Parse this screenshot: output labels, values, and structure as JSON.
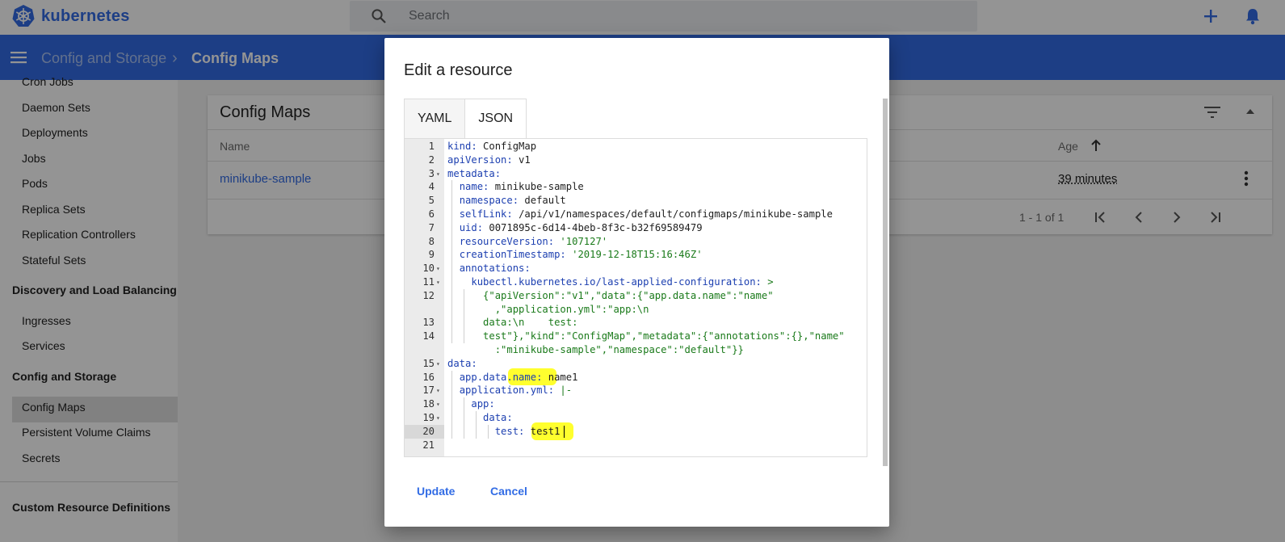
{
  "app": {
    "name": "kubernetes"
  },
  "search": {
    "placeholder": "Search"
  },
  "breadcrumb": {
    "parent": "Config and Storage",
    "current": "Config Maps"
  },
  "sidebar": {
    "items_top": [
      "Cron Jobs",
      "Daemon Sets",
      "Deployments",
      "Jobs",
      "Pods",
      "Replica Sets",
      "Replication Controllers",
      "Stateful Sets"
    ],
    "section_discovery": "Discovery and Load Balancing",
    "items_discovery": [
      "Ingresses",
      "Services"
    ],
    "section_config": "Config and Storage",
    "items_config": [
      "Config Maps",
      "Persistent Volume Claims",
      "Secrets"
    ],
    "section_crd": "Custom Resource Definitions"
  },
  "card": {
    "title": "Config Maps",
    "col_name": "Name",
    "col_age": "Age",
    "row_name": "minikube-sample",
    "row_age": "39 minutes",
    "pager": "1 - 1 of 1"
  },
  "dialog": {
    "title": "Edit a resource",
    "tab_yaml": "YAML",
    "tab_json": "JSON",
    "update_label": "Update",
    "cancel_label": "Cancel",
    "active_line": 20,
    "code_lines": [
      {
        "n": "1",
        "text": "kind: ConfigMap"
      },
      {
        "n": "2",
        "text": "apiVersion: v1"
      },
      {
        "n": "3",
        "text": "metadata:"
      },
      {
        "n": "4",
        "text": "  name: minikube-sample"
      },
      {
        "n": "5",
        "text": "  namespace: default"
      },
      {
        "n": "6",
        "text": "  selfLink: /api/v1/namespaces/default/configmaps/minikube-sample"
      },
      {
        "n": "7",
        "text": "  uid: 0071895c-6d14-4beb-8f3c-b32f69589479"
      },
      {
        "n": "8",
        "text": "  resourceVersion: '107127'"
      },
      {
        "n": "9",
        "text": "  creationTimestamp: '2019-12-18T15:16:46Z'"
      },
      {
        "n": "10",
        "text": "  annotations:"
      },
      {
        "n": "11",
        "text": "    kubectl.kubernetes.io/last-applied-configuration: >"
      },
      {
        "n": "12",
        "text": "      {\"apiVersion\":\"v1\",\"data\":{\"app.data.name\":\"name\""
      },
      {
        "n": "",
        "text": "        ,\"application.yml\":\"app:\\n"
      },
      {
        "n": "13",
        "text": "      data:\\n    test:"
      },
      {
        "n": "14",
        "text": "      test\"},\"kind\":\"ConfigMap\",\"metadata\":{\"annotations\":{},\"name\""
      },
      {
        "n": "",
        "text": "        :\"minikube-sample\",\"namespace\":\"default\"}}"
      },
      {
        "n": "15",
        "text": "data:"
      },
      {
        "n": "16",
        "text": "  app.data.name: name1"
      },
      {
        "n": "17",
        "text": "  application.yml: |-"
      },
      {
        "n": "18",
        "text": "    app:"
      },
      {
        "n": "19",
        "text": "      data:"
      },
      {
        "n": "20",
        "text": "        test: test1"
      },
      {
        "n": "21",
        "text": ""
      }
    ]
  },
  "colors": {
    "accent": "#326ce5",
    "highlight": "#ffff2e"
  }
}
